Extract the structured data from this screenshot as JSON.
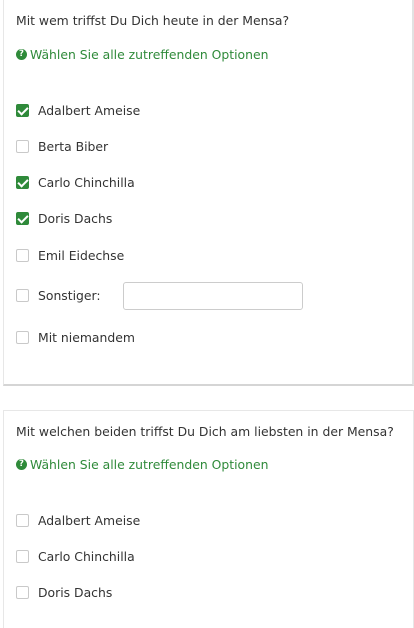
{
  "questions": [
    {
      "text": "Mit wem triffst Du Dich heute in der Mensa?",
      "hint": "Wählen Sie alle zutreffenden Optionen",
      "hint_icon": "question-circle-icon",
      "options": [
        {
          "label": "Adalbert Ameise",
          "checked": true
        },
        {
          "label": "Berta Biber",
          "checked": false
        },
        {
          "label": "Carlo Chinchilla",
          "checked": true
        },
        {
          "label": "Doris Dachs",
          "checked": true
        },
        {
          "label": "Emil Eidechse",
          "checked": false
        },
        {
          "label": "Sonstiger:",
          "checked": false,
          "other_value": ""
        },
        {
          "label": "Mit niemandem",
          "checked": false
        }
      ]
    },
    {
      "text": "Mit welchen beiden triffst Du Dich am liebsten in der Mensa?",
      "hint": "Wählen Sie alle zutreffenden Optionen",
      "hint_icon": "question-circle-icon",
      "options": [
        {
          "label": "Adalbert Ameise",
          "checked": false
        },
        {
          "label": "Carlo Chinchilla",
          "checked": false
        },
        {
          "label": "Doris Dachs",
          "checked": false
        }
      ]
    }
  ],
  "colors": {
    "accent": "#2f8a3a",
    "text": "#333333",
    "checkbox_border": "#c9c9c9"
  }
}
